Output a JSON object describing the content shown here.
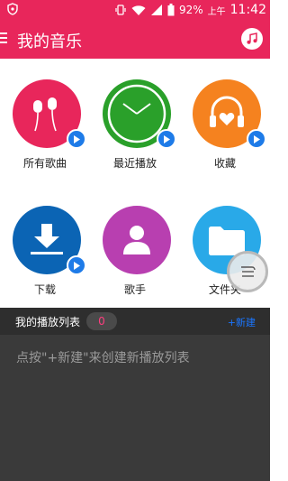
{
  "status_bar": {
    "battery_percent": "92%",
    "ampm": "上午",
    "time": "11:42",
    "icons": [
      "shield-icon",
      "vibrate-icon",
      "wifi-icon",
      "signal-icon",
      "battery-icon"
    ]
  },
  "app_bar": {
    "title": "我的音乐",
    "menu_icon": "menu-icon",
    "right_icon": "music-note-icon"
  },
  "tiles": [
    {
      "label": "所有歌曲",
      "color": "#e8265b",
      "icon": "earphones-icon"
    },
    {
      "label": "最近播放",
      "color": "#2aa02a",
      "icon": "clock-icon"
    },
    {
      "label": "收藏",
      "color": "#f5821f",
      "icon": "headphones-heart-icon"
    },
    {
      "label": "下载",
      "color": "#0b64b4",
      "icon": "download-icon"
    },
    {
      "label": "歌手",
      "color": "#b83fb0",
      "icon": "person-icon"
    },
    {
      "label": "文件夹",
      "color": "#29a9e8",
      "icon": "folder-icon"
    }
  ],
  "playlist": {
    "title": "我的播放列表",
    "count": "0",
    "new_label": "+新建",
    "empty_hint": "点按\"+新建\"来创建新播放列表"
  },
  "colors": {
    "accent": "#e8265b",
    "play_button": "#1e7be8",
    "link_blue": "#1a76ff"
  }
}
